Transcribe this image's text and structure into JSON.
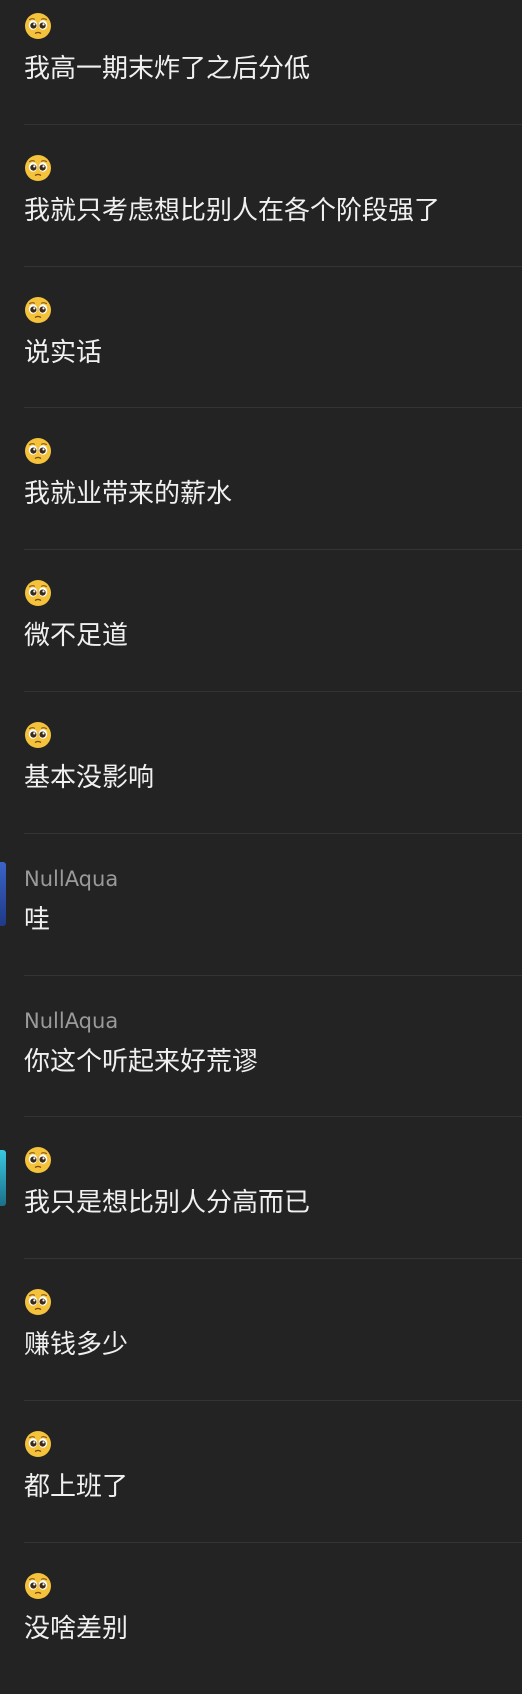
{
  "messages": [
    {
      "type": "emoji",
      "sender": "",
      "text": "我高一期末炸了之后分低"
    },
    {
      "type": "emoji",
      "sender": "",
      "text": "我就只考虑想比别人在各个阶段强了"
    },
    {
      "type": "emoji",
      "sender": "",
      "text": "说实话"
    },
    {
      "type": "emoji",
      "sender": "",
      "text": "我就业带来的薪水"
    },
    {
      "type": "emoji",
      "sender": "",
      "text": "微不足道"
    },
    {
      "type": "emoji",
      "sender": "",
      "text": "基本没影响"
    },
    {
      "type": "name",
      "sender": "NullAqua",
      "text": "哇"
    },
    {
      "type": "name",
      "sender": "NullAqua",
      "text": "你这个听起来好荒谬"
    },
    {
      "type": "emoji",
      "sender": "",
      "text": "我只是想比别人分高而已"
    },
    {
      "type": "emoji",
      "sender": "",
      "text": "赚钱多少"
    },
    {
      "type": "emoji",
      "sender": "",
      "text": "都上班了"
    },
    {
      "type": "emoji",
      "sender": "",
      "text": "没啥差别"
    }
  ],
  "sender_icon": "pleading-face-emoji-icon",
  "colors": {
    "background": "#232323",
    "separator": "#343434",
    "sender_name": "#9a9a9a",
    "message_text": "#f0f0f0",
    "emoji_face": "#f5c33b"
  }
}
